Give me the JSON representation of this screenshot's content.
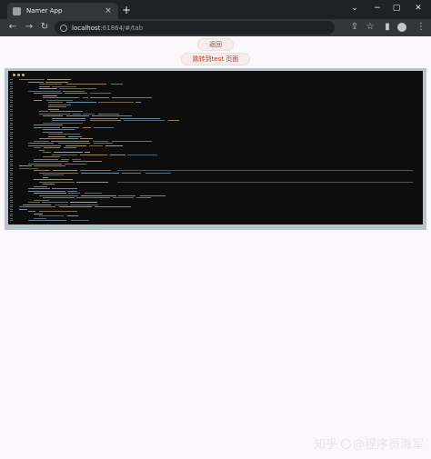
{
  "browser": {
    "tab_title": "Namer App",
    "tab_close": "×",
    "new_tab": "+",
    "url_host": "localhost",
    "url_rest": ":61864/#/tab",
    "window_controls": [
      "⌄",
      "−",
      "▢",
      "✕"
    ],
    "nav_icons": [
      "←",
      "→",
      "↻"
    ],
    "toolbar_icons": [
      "⇪",
      "☆",
      "▮"
    ]
  },
  "page": {
    "back_button": "返回",
    "jump_button": "跳转到test 页面"
  },
  "code_view": {
    "dot_colors": [
      "#e0b84a",
      "#e0b84a",
      "#e0b84a"
    ],
    "text_colors": [
      "#c9a96e",
      "#8aa0a8",
      "#7fa6c6",
      "#b9b9b9"
    ]
  },
  "watermark": {
    "text_before": "知乎",
    "text_after": "@程序员海军"
  }
}
